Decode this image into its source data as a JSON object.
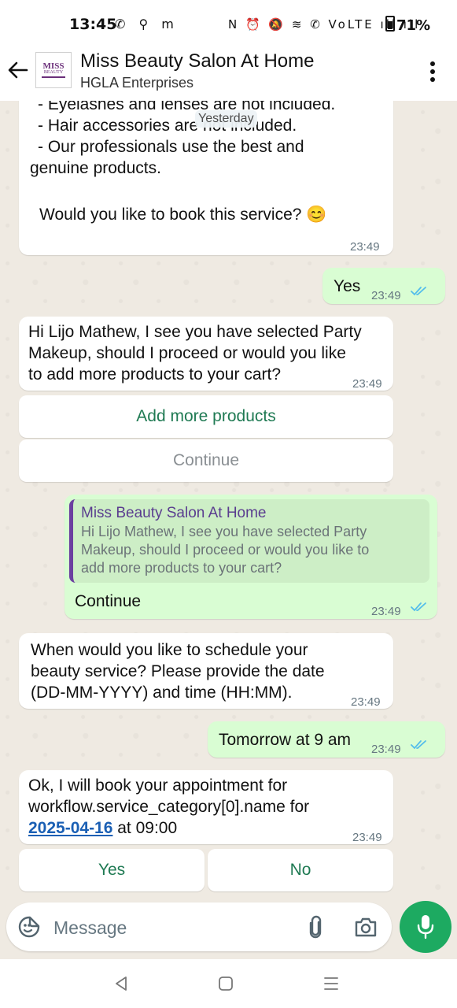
{
  "status_bar": {
    "time": "13:45",
    "left_icons": "✆ ⚲ m",
    "right_icons": "N ⏰ 🔕 ≋ ✆ VoLTE ıll ıll",
    "battery": "71%"
  },
  "header": {
    "contact_name": "Miss Beauty Salon At Home",
    "subtitle": "HGLA Enterprises",
    "avatar_text": "MISS",
    "avatar_subtext": "BEAUTY"
  },
  "chat": {
    "date_pill": "Yesterday",
    "messages": [
      {
        "lines": [
          "- Eyelashes and lenses are not included.",
          "- Hair accessories are not included.",
          "- Our professionals use the best and",
          "genuine products."
        ],
        "question": "Would you like to book this service? 😊",
        "time": "23:49"
      },
      {
        "text": "Yes",
        "time": "23:49"
      },
      {
        "lines": [
          "Hi Lijo Mathew, I see you have selected Party",
          "Makeup, should I proceed or would you like",
          "to add more products to your cart?"
        ],
        "time": "23:49"
      },
      {
        "quote_author": "Miss Beauty Salon At Home",
        "quote_lines": [
          "Hi Lijo Mathew, I see you have selected Party",
          "Makeup, should I proceed or would you like to",
          "add more products to your cart?"
        ],
        "text": "Continue",
        "time": "23:49"
      },
      {
        "lines": [
          "When would you like to schedule your",
          "beauty service? Please provide the date",
          "(DD-MM-YYYY) and time (HH:MM)."
        ],
        "time": "23:49"
      },
      {
        "text": "Tomorrow at 9 am",
        "time": "23:49"
      },
      {
        "lines": [
          "Ok, I will book your appointment for",
          "workflow.service_category[0].name for"
        ],
        "date_link": "2025-04-16",
        "after_link": " at 09:00",
        "time": "23:49"
      }
    ],
    "buttons_1": {
      "add_more": "Add more products",
      "continue": "Continue"
    },
    "buttons_2": {
      "yes": "Yes",
      "no": "No"
    }
  },
  "input": {
    "placeholder": "Message"
  },
  "colors": {
    "accent_green": "#1daa61",
    "outgoing_bubble": "#d9fdd3",
    "link_blue": "#1a5fb4",
    "read_ticks": "#53bdeb"
  }
}
